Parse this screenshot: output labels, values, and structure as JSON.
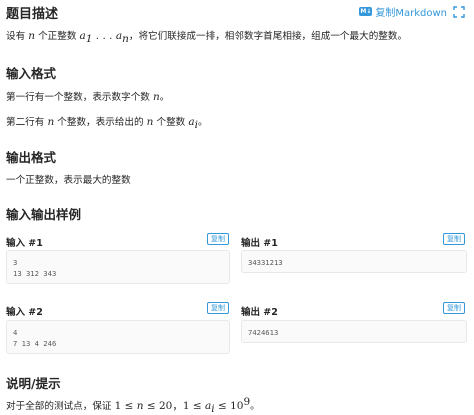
{
  "problem": {
    "title": "题目描述",
    "toolbar": {
      "copy_markdown": "复制Markdown",
      "expand_label": "",
      "accent": "#3498db"
    },
    "description": {
      "pre": "设有 ",
      "n": "n",
      "mid1": " 个正整数 ",
      "a": "a",
      "sub1": "1",
      "dots": " . . . ",
      "sub_n": "n",
      "post": "，将它们联接成一排，相邻数字首尾相接，组成一个最大的整数。"
    },
    "input_format": {
      "title": "输入格式",
      "line1_pre": "第一行有一个整数，表示数字个数 ",
      "line1_var": "n",
      "line1_post": "。",
      "line2_pre": "第二行有 ",
      "line2_var": "n",
      "line2_mid": " 个整数，表示给出的 ",
      "line2_var2": "n",
      "line2_mid2": " 个整数 ",
      "line2_a": "a",
      "line2_sub": "i",
      "line2_post": "。"
    },
    "output_format": {
      "title": "输出格式",
      "line1": "一个正整数，表示最大的整数"
    },
    "samples": {
      "title": "输入输出样例",
      "copy_label": "复制",
      "items": [
        {
          "input_label": "输入 #1",
          "input": "3\n13 312 343",
          "output_label": "输出 #1",
          "output": "34331213"
        },
        {
          "input_label": "输入 #2",
          "input": "4\n7 13 4 246",
          "output_label": "输出 #2",
          "output": "7424613"
        }
      ]
    },
    "hint": {
      "title": "说明/提示",
      "pre": "对于全部的测试点，保证 ",
      "c1": "1 ≤ ",
      "n": "n",
      "c2": " ≤ 20，1 ≤ ",
      "a": "a",
      "sub": "i",
      "c3": " ≤ 10",
      "sup": "9",
      "post": "。"
    }
  }
}
